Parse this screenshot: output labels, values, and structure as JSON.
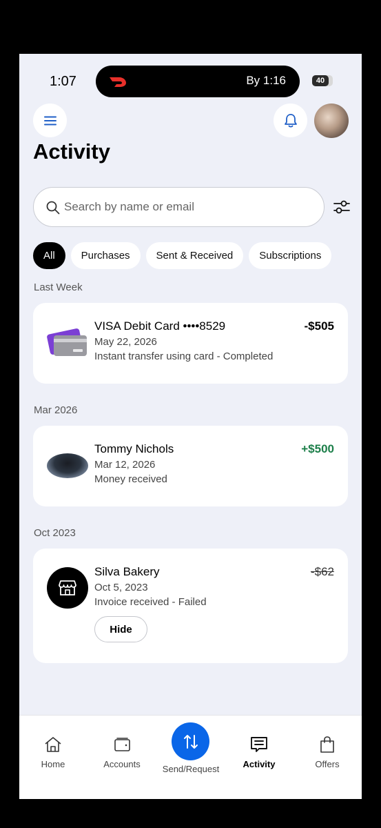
{
  "status": {
    "time": "1:07",
    "eta": "By 1:16",
    "battery": "40"
  },
  "header": {
    "title": "Activity"
  },
  "search": {
    "placeholder": "Search by name or email"
  },
  "chips": [
    "All",
    "Purchases",
    "Sent & Received",
    "Subscriptions"
  ],
  "sections": [
    {
      "label": "Last Week",
      "items": [
        {
          "name": "VISA Debit Card ••••8529",
          "date": "May 22, 2026",
          "desc": "Instant transfer using card - Completed",
          "amount": "-$505"
        }
      ]
    },
    {
      "label": "Mar 2026",
      "items": [
        {
          "name": "Tommy Nichols",
          "date": "Mar 12, 2026",
          "desc": "Money received",
          "amount": "+$500"
        }
      ]
    },
    {
      "label": "Oct 2023",
      "items": [
        {
          "name": "Silva Bakery",
          "date": "Oct 5, 2023",
          "desc": "Invoice received - Failed",
          "amount": "-$62",
          "action": "Hide"
        }
      ]
    }
  ],
  "nav": {
    "home": "Home",
    "accounts": "Accounts",
    "send": "Send/Request",
    "activity": "Activity",
    "offers": "Offers"
  },
  "colors": {
    "accent": "#0a66e8",
    "positive": "#1d7f4a",
    "background": "#eef0f8"
  }
}
